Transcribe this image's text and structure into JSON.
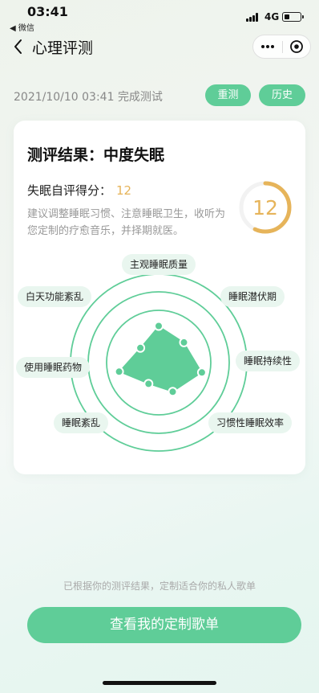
{
  "status_bar": {
    "time": "03:41",
    "back_app": "◀ 微信",
    "network": "4G",
    "battery_level": 0.35
  },
  "nav": {
    "title": "心理评测"
  },
  "test_info": {
    "completed_text": "2021/10/10 03:41 完成测试",
    "retest_label": "重测",
    "history_label": "历史"
  },
  "result": {
    "title": "测评结果：中度失眠",
    "score_label": "失眠自评得分：",
    "score": "12",
    "advice": "建议调整睡眠习惯、注意睡眠卫生，收听为您定制的疗愈音乐，并择期就医。",
    "gauge_value": "12",
    "gauge_fraction": 0.57
  },
  "radar": {
    "dimensions": [
      {
        "label": "主观睡眠质量",
        "value": 0.7
      },
      {
        "label": "睡眠潜伏期",
        "value": 0.62
      },
      {
        "label": "睡眠持续性",
        "value": 0.85
      },
      {
        "label": "习惯性睡眠效率",
        "value": 0.62
      },
      {
        "label": "睡眠紊乱",
        "value": 0.45
      },
      {
        "label": "使用睡眠药物",
        "value": 0.78
      },
      {
        "label": "白天功能紊乱",
        "value": 0.45
      }
    ]
  },
  "footer": {
    "hint": "已根据你的测评结果，定制适合你的私人歌单",
    "cta_label": "查看我的定制歌单"
  },
  "colors": {
    "accent": "#5fcd98",
    "gauge": "#e6b45a",
    "radar_fill": "#5fcd98"
  }
}
